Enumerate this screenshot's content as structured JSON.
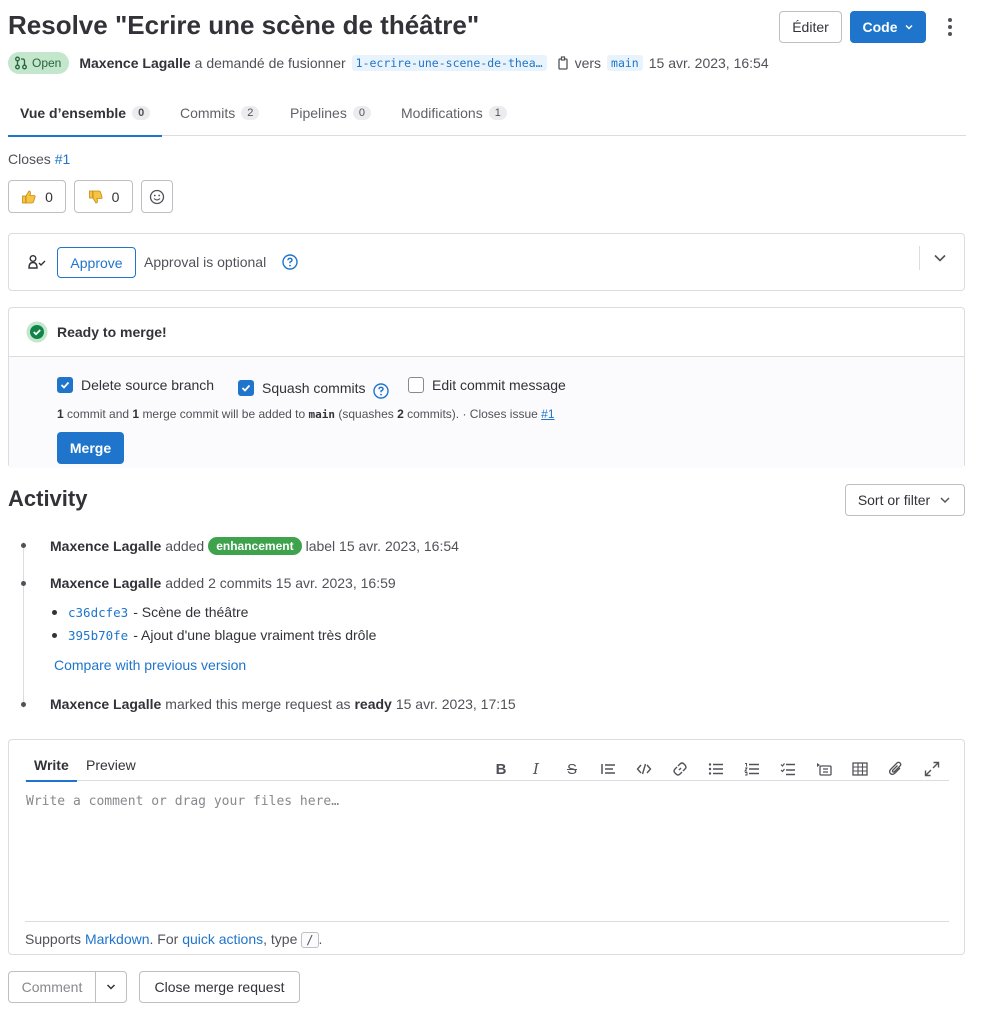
{
  "header": {
    "title": "Resolve \"Ecrire une scène de théâtre\"",
    "edit_label": "Éditer",
    "code_label": "Code",
    "status": "Open",
    "author": "Maxence Lagalle",
    "action_text": "a demandé de fusionner",
    "source_branch": "1-ecrire-une-scene-de-thea…",
    "vers": "vers",
    "target_branch": "main",
    "date": "15 avr. 2023, 16:54"
  },
  "tabs": [
    {
      "label": "Vue d’ensemble",
      "count": "0"
    },
    {
      "label": "Commits",
      "count": "2"
    },
    {
      "label": "Pipelines",
      "count": "0"
    },
    {
      "label": "Modifications",
      "count": "1"
    }
  ],
  "closes": {
    "text": "Closes",
    "issue": "#1"
  },
  "reactions": {
    "thumbs_up": "0",
    "thumbs_down": "0"
  },
  "approval": {
    "button": "Approve",
    "text": "Approval is optional"
  },
  "merge": {
    "ready": "Ready to merge!",
    "opt_delete": "Delete source branch",
    "opt_squash": "Squash commits",
    "opt_edit": "Edit commit message",
    "note": {
      "n1": "1",
      "t1": "commit and",
      "n2": "1",
      "t2": "merge commit will be added to",
      "branch": "main",
      "t3": "(squashes",
      "n3": "2",
      "t4": "commits). · Closes issue",
      "issue": "#1"
    },
    "button": "Merge"
  },
  "activity": {
    "title": "Activity",
    "sort_label": "Sort or filter",
    "items": [
      {
        "author": "Maxence Lagalle",
        "pre": "added",
        "label": "enhancement",
        "post": "label 15 avr. 2023, 16:54"
      },
      {
        "author": "Maxence Lagalle",
        "text": "added 2 commits 15 avr. 2023, 16:59"
      },
      {
        "author": "Maxence Lagalle",
        "pre": "marked this merge request as",
        "bold": "ready",
        "post": "15 avr. 2023, 17:15"
      }
    ],
    "commits": [
      {
        "sha": "c36dcfe3",
        "message": "- Scène de théâtre"
      },
      {
        "sha": "395b70fe",
        "message": "- Ajout d'une blague vraiment très drôle"
      }
    ],
    "compare_link": "Compare with previous version"
  },
  "comment": {
    "tab_write": "Write",
    "tab_preview": "Preview",
    "placeholder": "Write a comment or drag your files here…",
    "foot_pre": "Supports",
    "foot_markdown": "Markdown",
    "foot_mid": ". For",
    "foot_quick": "quick actions",
    "foot_type": ", type",
    "foot_slash": "/",
    "foot_end": ".",
    "comment_button": "Comment",
    "close_button": "Close merge request"
  },
  "colors": {
    "accent": "#1f75cb",
    "success": "#108548",
    "label": "#3fa34d"
  }
}
